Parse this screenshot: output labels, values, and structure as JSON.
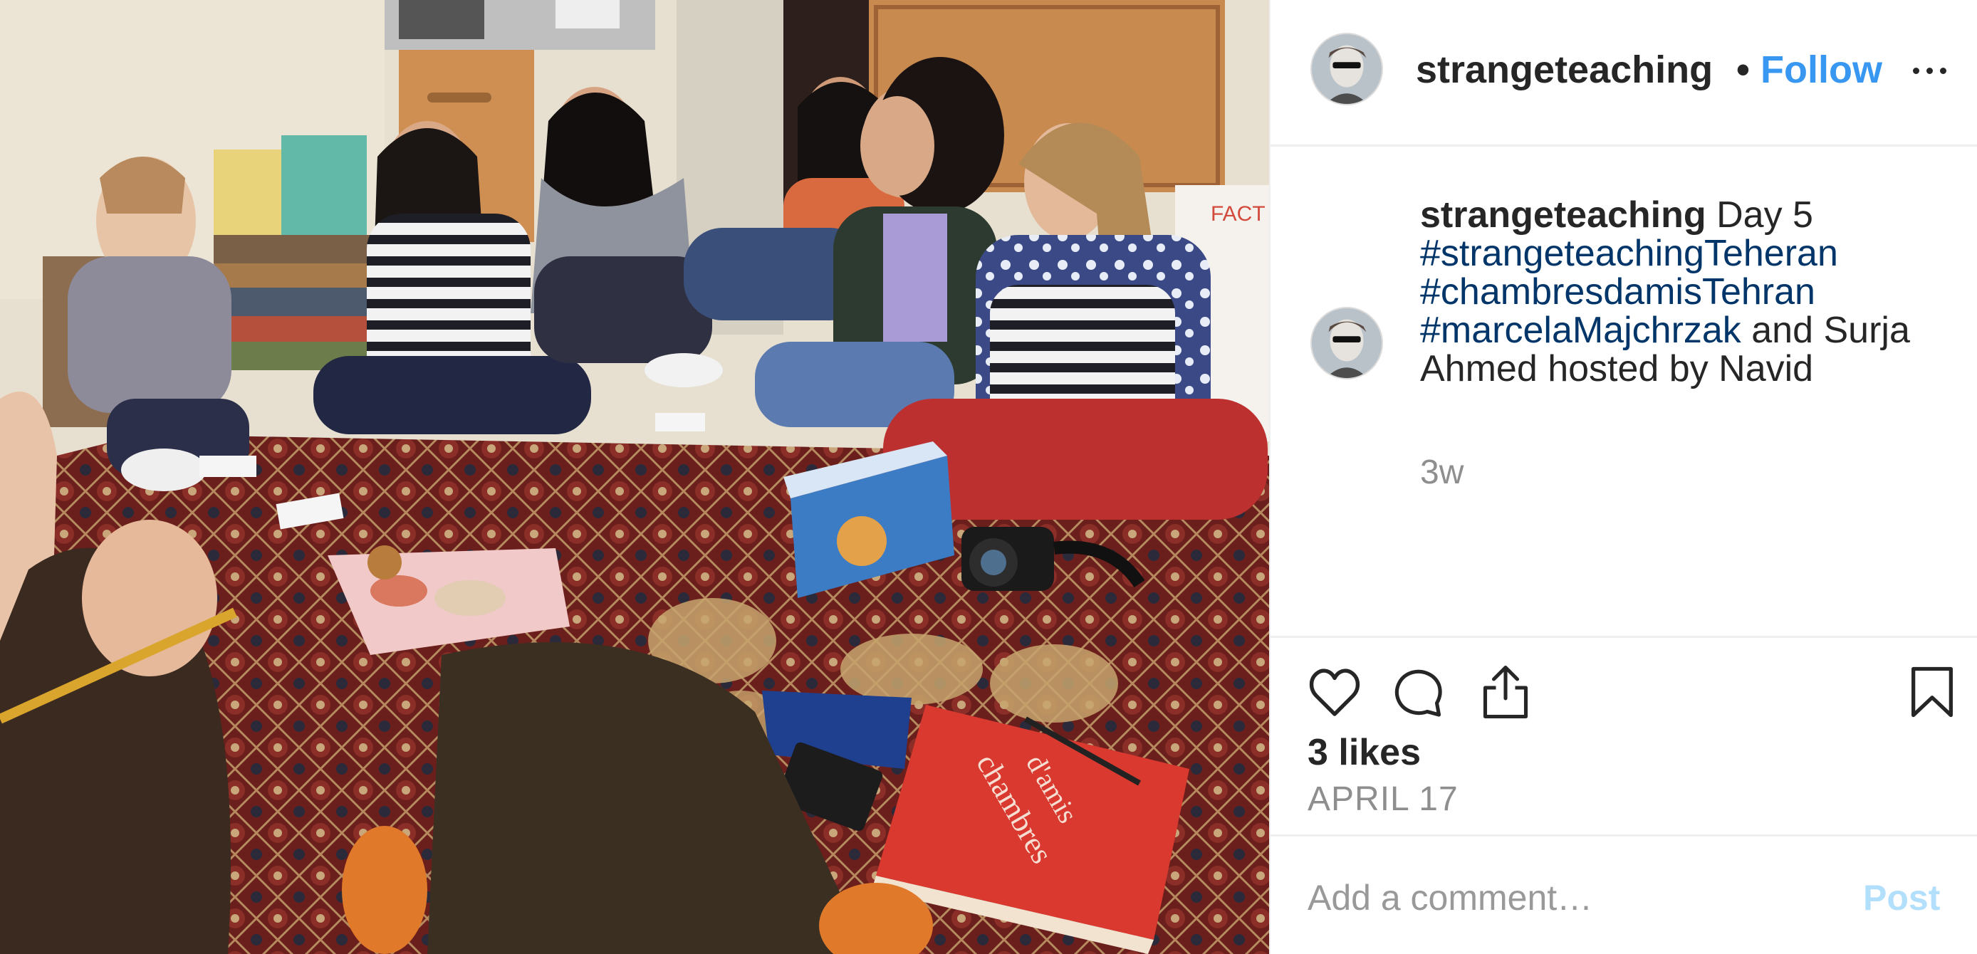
{
  "post": {
    "username": "strangeteaching",
    "separator": "•",
    "follow_label": "Follow",
    "more_icon": "more-horizontal-icon",
    "photo_alt": "Group of young women sitting on a Persian carpet around books, snacks and a camera"
  },
  "caption": {
    "username": "strangeteaching",
    "text_1": "Day 5",
    "hashtag_1": "#strangeteachingTeheran",
    "hashtag_2": "#chambresdamisTehran",
    "hashtag_3": "#marcelaMajchrzak",
    "text_2": "and Surja Ahmed hosted by Navid",
    "time_ago": "3w"
  },
  "actions": {
    "like_icon": "heart-icon",
    "comment_icon": "comment-bubble-icon",
    "share_icon": "share-icon",
    "save_icon": "bookmark-icon",
    "likes": "3 likes",
    "date": "APRIL 17"
  },
  "comment_box": {
    "placeholder": "Add a comment…",
    "post_label": "Post"
  },
  "colors": {
    "link_blue": "#3897f0",
    "hashtag_blue": "#003569",
    "muted_gray": "#8e8e8e",
    "post_disabled": "#b2dffc",
    "text": "#262626"
  }
}
